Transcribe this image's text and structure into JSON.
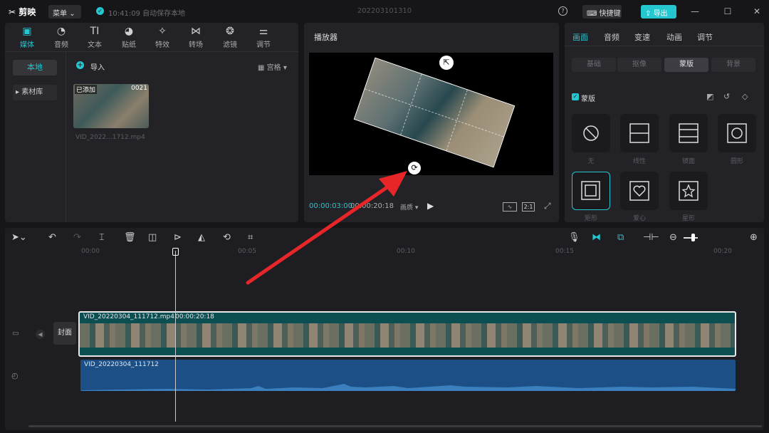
{
  "titlebar": {
    "app_name": "剪映",
    "menu_label": "菜单",
    "autosave": "10:41:09 自动保存本地",
    "project_title": "202203101310",
    "shortcut_label": "快捷键",
    "export_label": "导出"
  },
  "toolbar": {
    "items": [
      {
        "label": "媒体",
        "icon": "media-icon"
      },
      {
        "label": "音频",
        "icon": "audio-icon"
      },
      {
        "label": "文本",
        "icon": "text-icon"
      },
      {
        "label": "贴纸",
        "icon": "sticker-icon"
      },
      {
        "label": "特效",
        "icon": "effects-icon"
      },
      {
        "label": "转场",
        "icon": "transition-icon"
      },
      {
        "label": "滤镜",
        "icon": "filter-icon"
      },
      {
        "label": "调节",
        "icon": "adjust-icon"
      }
    ]
  },
  "media": {
    "sidebar": [
      "本地",
      "素材库"
    ],
    "import_label": "导入",
    "view_label": "宫格",
    "clip": {
      "badge": "已添加",
      "duration": "0021",
      "name": "VID_2022...1712.mp4"
    }
  },
  "player": {
    "title": "播放器",
    "current_time": "00:00:03:00",
    "total_time": "00:00:20:18",
    "quality": "画质",
    "ratio": "2:1"
  },
  "right_panel": {
    "tabs": [
      "画面",
      "音频",
      "变速",
      "动画",
      "调节"
    ],
    "subtabs": [
      "基础",
      "抠像",
      "蒙版",
      "背景"
    ],
    "mask_toggle": "蒙版",
    "masks": [
      "无",
      "线性",
      "镜面",
      "圆形",
      "矩形",
      "爱心",
      "星形"
    ]
  },
  "timeline": {
    "ticks": [
      "00:00",
      "00:05",
      "00:10",
      "00:15",
      "00:20"
    ],
    "cover_label": "封面",
    "video_clip_label": "VID_20220304_111712.mp4",
    "video_clip_duration": "00:00:20:18",
    "audio_clip_label": "VID_20220304_111712"
  },
  "colors": {
    "accent": "#24c7cf",
    "arrow": "#e8262a",
    "video_track": "#0b4f52",
    "audio_track": "#1b4f86"
  }
}
